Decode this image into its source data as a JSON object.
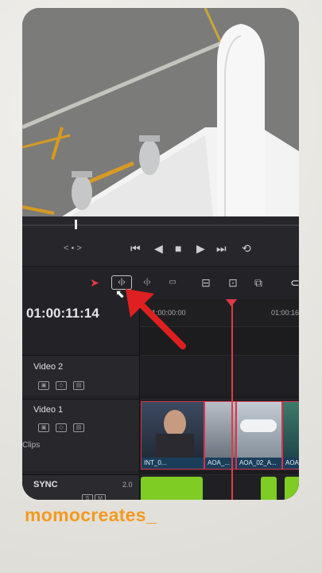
{
  "transport": {
    "jog_label": "< • >",
    "buttons": [
      "skip-back",
      "play-reverse",
      "stop",
      "play",
      "skip-forward",
      "loop"
    ]
  },
  "toolbar": {
    "tools": [
      "select-tool",
      "blade-edit-tool",
      "trim-tool",
      "dynamic-trim-tool",
      "insert-clip",
      "overwrite-clip",
      "replace-clip",
      "link-tool"
    ]
  },
  "timeline": {
    "timecode": "01:00:11:14",
    "ruler": {
      "start": "01:00:00:00",
      "next": "01:00:16"
    },
    "tracks": {
      "video2": {
        "name": "Video 2"
      },
      "video1": {
        "name": "Video 1",
        "subtitle": "Clips"
      },
      "audio": {
        "name": "SYNC",
        "level": "2.0",
        "buttons": [
          "S",
          "M"
        ]
      }
    },
    "clips": [
      {
        "label": "INT_0..."
      },
      {
        "label": "AOA_..."
      },
      {
        "label": "AOA_02_A..."
      },
      {
        "label": "AOA"
      }
    ]
  },
  "colors": {
    "playhead": "#e23a45",
    "audio_clip": "#7fcc24",
    "brand": "#f39a1f"
  },
  "brand": {
    "handle": "momocreates_"
  }
}
